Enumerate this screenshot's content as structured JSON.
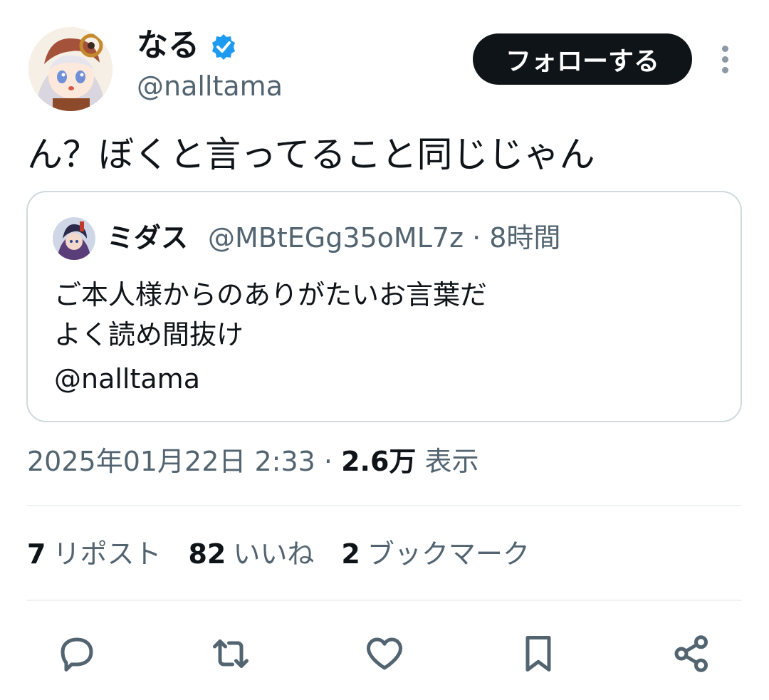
{
  "author": {
    "name": "なる",
    "handle": "@nalltama",
    "avatar_icon": "avatar-icon",
    "verified_icon": "verified-badge-icon",
    "verified_color": "#1d9bf0"
  },
  "follow_button": {
    "label": "フォローする"
  },
  "more_menu": {
    "icon": "more-vertical-icon"
  },
  "tweet": {
    "text": "ん？ぼくと言ってること同じじゃん"
  },
  "quote": {
    "name": "ミダス",
    "handle_time": "@MBtEGg35oML7z · 8時間",
    "lines": [
      "ご本人様からのありがたいお言葉だ",
      "よく読め間抜け",
      "@nalltama"
    ]
  },
  "meta": {
    "timestamp": "2025年01月22日 2:33 · ",
    "views_count": "2.6万",
    "views_label": " 表示"
  },
  "stats": [
    {
      "count": "7",
      "label": "リポスト"
    },
    {
      "count": "82",
      "label": "いいね"
    },
    {
      "count": "2",
      "label": "ブックマーク"
    }
  ],
  "actions": [
    "reply-icon",
    "retweet-icon",
    "like-icon",
    "bookmark-icon",
    "share-icon"
  ],
  "colors": {
    "text": "#0f1419",
    "secondary": "#536471",
    "border": "#cfd9de",
    "button": "#0f1419"
  }
}
